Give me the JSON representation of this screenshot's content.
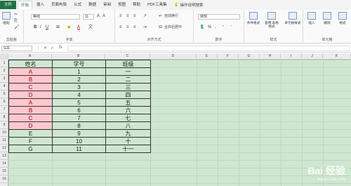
{
  "tabs": [
    "文件",
    "开始",
    "插入",
    "页面布局",
    "公式",
    "数据",
    "审阅",
    "视图",
    "帮助",
    "PDF工具集"
  ],
  "search_label": "操作说明搜索",
  "ribbon": {
    "clipboard": {
      "paste": "粘贴",
      "label": "剪贴板"
    },
    "font": {
      "name": "等线",
      "size": "11",
      "label": "字体"
    },
    "alignment": {
      "wrap": "自动换行",
      "merge": "合并后居中",
      "label": "对齐方式"
    },
    "number": {
      "format": "常规",
      "label": "数字"
    },
    "styles": {
      "conditional": "条件格式",
      "table": "套用\n表格格式",
      "cell": "单元格样式",
      "label": "样式"
    },
    "cells": {
      "insert": "插入",
      "delete": "删除",
      "format": "格式",
      "label": "单元格"
    }
  },
  "formula_bar": {
    "name_box": "G11",
    "fx": "fx",
    "value": ""
  },
  "columns": [
    "A",
    "B",
    "C",
    "D",
    "E",
    "F",
    "G",
    "H",
    "I",
    "J",
    "K"
  ],
  "rows": [
    "1",
    "2",
    "3",
    "4",
    "5",
    "6",
    "7",
    "8",
    "9",
    "10",
    "11",
    "12",
    "13",
    "14",
    "15",
    "16"
  ],
  "table": {
    "headers": [
      "姓名",
      "学号",
      "班级"
    ],
    "rows": [
      [
        "A",
        "1",
        "一",
        true
      ],
      [
        "B",
        "2",
        "二",
        true
      ],
      [
        "C",
        "3",
        "三",
        true
      ],
      [
        "D",
        "4",
        "四",
        true
      ],
      [
        "A",
        "5",
        "五",
        true
      ],
      [
        "B",
        "6",
        "六",
        true
      ],
      [
        "C",
        "7",
        "七",
        true
      ],
      [
        "D",
        "8",
        "八",
        true
      ],
      [
        "E",
        "9",
        "九",
        false
      ],
      [
        "F",
        "10",
        "十",
        false
      ],
      [
        "G",
        "11",
        "十一",
        false
      ]
    ]
  },
  "watermark": {
    "text": "Bai 经验",
    "url": "jingyan.baidu.com"
  }
}
